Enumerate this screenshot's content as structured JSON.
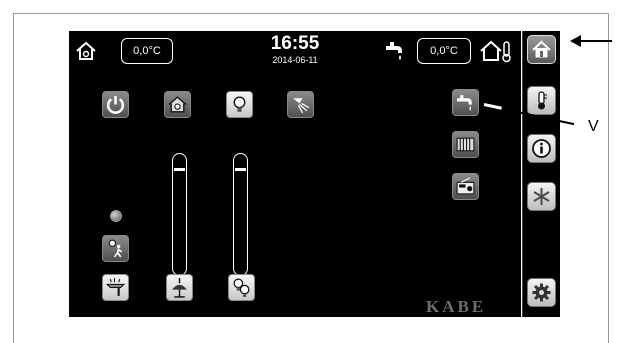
{
  "header": {
    "inside_temp": "0,0°C",
    "outside_temp": "0,0°C",
    "time": "16:55",
    "date": "2014-06-11"
  },
  "sidebar": {
    "items": [
      {
        "id": "home",
        "icon": "home-icon",
        "active": true
      },
      {
        "id": "temperature",
        "icon": "thermometer-icon"
      },
      {
        "id": "info",
        "icon": "info-icon"
      },
      {
        "id": "frost",
        "icon": "snowflake-icon"
      },
      {
        "id": "settings",
        "icon": "gear-icon"
      }
    ]
  },
  "main": {
    "top_buttons": [
      "power-icon",
      "house-light-icon",
      "bulb-icon",
      "ceiling-spot-icon"
    ],
    "right_buttons": [
      "water-tap-icon",
      "heater-icon",
      "radio-icon"
    ],
    "left_column": [
      "status-lamp",
      "motion-sensor-icon",
      "awning-light-icon"
    ],
    "bottom_buttons": [
      "pendant-lamp-icon",
      "bulbs-icon"
    ],
    "brand": "KABE"
  },
  "annotations": {
    "callout_label": "V"
  },
  "colors": {
    "screen_bg": "#000000",
    "button_light": "#e8e8e8",
    "button_dark": "#6a6a6a"
  }
}
